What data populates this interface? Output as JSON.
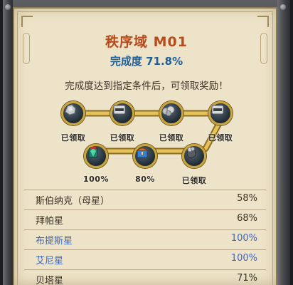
{
  "panel": {
    "title": "秩序域 M01",
    "completion": "完成度 71.8%",
    "instruction": "完成度达到指定条件后，可领取奖励！"
  },
  "rewards": [
    {
      "label": "已领取",
      "icon": "silver-ore-icon"
    },
    {
      "label": "已领取",
      "icon": "resource-crate-icon"
    },
    {
      "label": "已领取",
      "icon": "rock-pile-icon"
    },
    {
      "label": "已领取",
      "icon": "resource-crate-icon"
    },
    {
      "label": "100%",
      "icon": "green-crystal-icon"
    },
    {
      "label": "80%",
      "icon": "blue-treasure-chest-icon"
    },
    {
      "label": "已领取",
      "icon": "ore-sack-icon"
    }
  ],
  "planets": [
    {
      "name": "斯伯纳克（母星）",
      "percent": "58%",
      "complete": false
    },
    {
      "name": "拜帕星",
      "percent": "68%",
      "complete": false
    },
    {
      "name": "布提斯星",
      "percent": "100%",
      "complete": true
    },
    {
      "name": "艾尼星",
      "percent": "100%",
      "complete": true
    },
    {
      "name": "贝塔星",
      "percent": "71%",
      "complete": false
    }
  ],
  "colors": {
    "title": "#b84a1c",
    "completion": "#1e5f9a",
    "complete_row": "#3c68c4",
    "track_gold": "#d9b54a",
    "parchment": "#ede3c8"
  }
}
